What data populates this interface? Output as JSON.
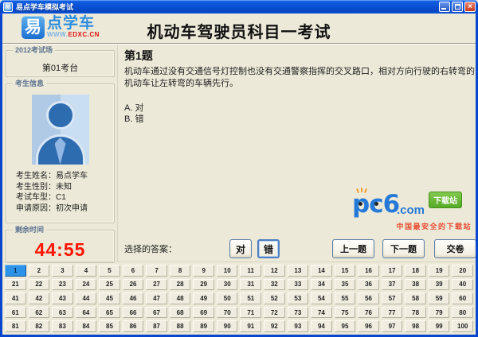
{
  "window": {
    "title": "易点学车模拟考试",
    "icon_char": "易",
    "controls": {
      "minimize": "minimize",
      "maximize": "maximize",
      "close": "close"
    }
  },
  "header": {
    "logo": {
      "icon_char": "易",
      "brand": "点学车",
      "url_www": "WWW.",
      "url_main": "EDXC",
      "url_tld": ".CN"
    },
    "title": "机动车驾驶员科目一考试"
  },
  "sidebar": {
    "exam_site": {
      "label": "2012考试场",
      "value": "第01考台"
    },
    "candidate": {
      "label": "考生信息",
      "fields": [
        {
          "name": "考生姓名",
          "value": "易点学车"
        },
        {
          "name": "考生性别",
          "value": "未知"
        },
        {
          "name": "考试车型",
          "value": "C1"
        },
        {
          "name": "申请原因",
          "value": "初次申请"
        }
      ]
    },
    "timer": {
      "label": "剩余时间",
      "value": "44:55"
    }
  },
  "question": {
    "number_label": "第1题",
    "text": "机动车通过没有交通信号灯控制也没有交通警察指挥的交叉路口，相对方向行驶的右转弯的机动车让左转弯的车辆先行。",
    "options": [
      "A. 对",
      "B. 错"
    ]
  },
  "answer_bar": {
    "label": "选择的答案：",
    "true_button": "对",
    "false_button": "错",
    "prev_button": "上一题",
    "next_button": "下一题",
    "submit_button": "交卷"
  },
  "watermark": {
    "brand": "pc6",
    "dot_com": ".com",
    "badge": "下载站",
    "tagline": "中国最安全的下载站"
  },
  "grid": {
    "count": 100,
    "current": 1
  },
  "colors": {
    "titlebar_blue": "#0A51D6",
    "window_border": "#0846CE",
    "dialog_beige": "#ECE9D8",
    "timer_red": "#FF1400",
    "selected_cell_blue": "#2D93E8",
    "brand_blue": "#2B8CE0",
    "brand_red": "#E01010",
    "watermark_blue": "#1B74D8",
    "watermark_green": "#4EA81E",
    "watermark_red": "#E8442A"
  }
}
